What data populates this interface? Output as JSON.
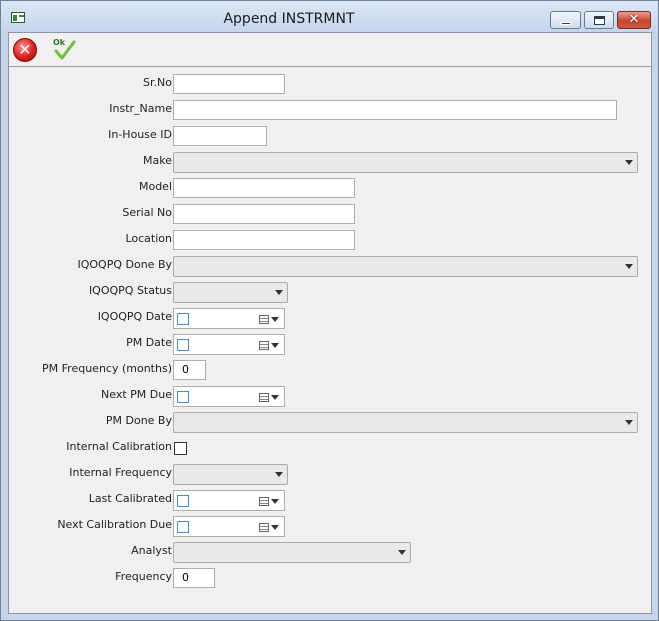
{
  "window": {
    "title": "Append INSTRMNT",
    "minimize_label": "",
    "maximize_label": "",
    "close_label": "✕"
  },
  "toolbar": {
    "cancel_label": "✕",
    "ok_label": "Ok"
  },
  "form": {
    "sr_no": {
      "label": "Sr.No",
      "value": ""
    },
    "instr_name": {
      "label": "Instr_Name",
      "value": ""
    },
    "in_house_id": {
      "label": "In-House ID",
      "value": ""
    },
    "make": {
      "label": "Make",
      "value": ""
    },
    "model": {
      "label": "Model",
      "value": ""
    },
    "serial_no": {
      "label": "Serial No",
      "value": ""
    },
    "location": {
      "label": "Location",
      "value": ""
    },
    "iqoqpq_done_by": {
      "label": "IQOQPQ Done By",
      "value": ""
    },
    "iqoqpq_status": {
      "label": "IQOQPQ Status",
      "value": ""
    },
    "iqoqpq_date": {
      "label": "IQOQPQ Date",
      "checked": false
    },
    "pm_date": {
      "label": "PM Date",
      "checked": false
    },
    "pm_frequency": {
      "label": "PM Frequency (months)",
      "value": "0"
    },
    "next_pm_due": {
      "label": "Next PM Due",
      "checked": false
    },
    "pm_done_by": {
      "label": "PM Done By",
      "value": ""
    },
    "internal_calibration": {
      "label": "Internal Calibration",
      "checked": false
    },
    "internal_frequency": {
      "label": "Internal Frequency",
      "value": ""
    },
    "last_calibrated": {
      "label": "Last Calibrated",
      "checked": false
    },
    "next_calibration_due": {
      "label": "Next Calibration Due",
      "checked": false
    },
    "analyst": {
      "label": "Analyst",
      "value": ""
    },
    "frequency": {
      "label": "Frequency",
      "value": "0"
    }
  },
  "colors": {
    "title_bar": "#c6d6ea",
    "form_background": "#f0f0f0",
    "close_button": "#c5472e",
    "cancel_icon": "#dd1f1f",
    "ok_check": "#6cc23a"
  }
}
